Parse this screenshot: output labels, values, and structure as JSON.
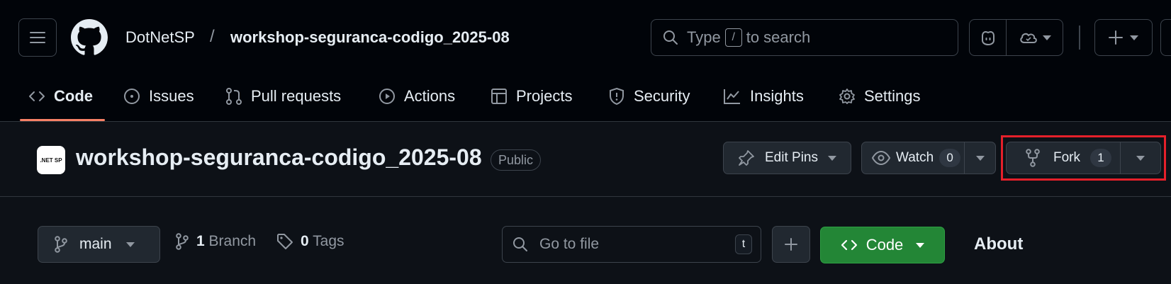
{
  "header": {
    "owner": "DotNetSP",
    "separator": "/",
    "repo": "workshop-seguranca-codigo_2025-08",
    "search": {
      "prefix": "Type",
      "key": "/",
      "suffix": "to search"
    }
  },
  "nav_tabs": [
    {
      "label": "Code",
      "icon": "code-icon",
      "active": true
    },
    {
      "label": "Issues",
      "icon": "issue-opened-icon"
    },
    {
      "label": "Pull requests",
      "icon": "git-pull-request-icon"
    },
    {
      "label": "Actions",
      "icon": "play-icon"
    },
    {
      "label": "Projects",
      "icon": "table-icon"
    },
    {
      "label": "Security",
      "icon": "shield-icon"
    },
    {
      "label": "Insights",
      "icon": "graph-icon"
    },
    {
      "label": "Settings",
      "icon": "gear-icon"
    }
  ],
  "repo_header": {
    "avatar_text": ".NET SP",
    "title": "workshop-seguranca-codigo_2025-08",
    "visibility": "Public",
    "edit_pins_label": "Edit Pins",
    "watch_label": "Watch",
    "watch_count": "0",
    "fork_label": "Fork",
    "fork_count": "1"
  },
  "toolbar": {
    "branch": "main",
    "branch_count": "1",
    "branch_label": "Branch",
    "tag_count": "0",
    "tag_label": "Tags",
    "go_to_file_placeholder": "Go to file",
    "go_to_file_key": "t",
    "code_button_label": "Code"
  },
  "sidebar": {
    "about_title": "About"
  },
  "colors": {
    "background": "#0d1117",
    "header_background": "#010409",
    "active_tab_underline": "#f78166",
    "code_button": "#238636",
    "highlight_box": "#e5202a"
  }
}
